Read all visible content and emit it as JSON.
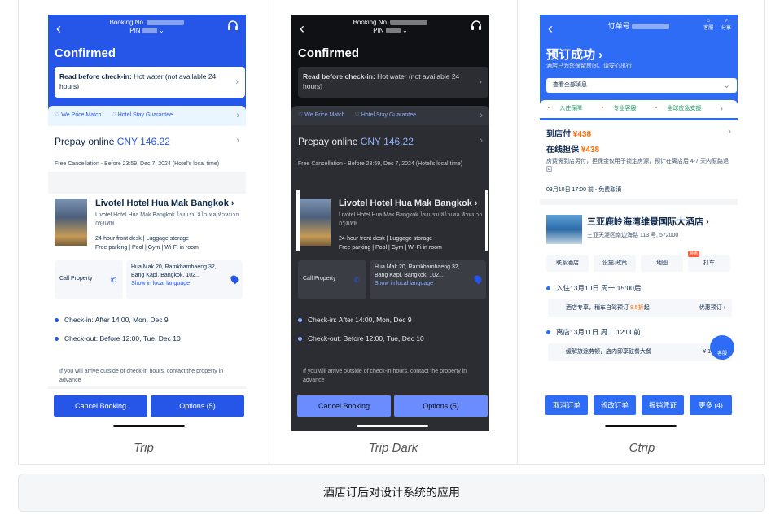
{
  "panels": [
    {
      "caption": "Trip",
      "booking": "Booking No.",
      "pin": "PIN",
      "title": "Confirmed",
      "notice_bold": "Read before check-in:",
      "notice_text": " Hot water (not available 24 hours)",
      "guar1": "We Price Match",
      "guar2": "Hotel Stay Guarantee",
      "prepay_label": "Prepay online ",
      "prepay_amount": "CNY 146.22",
      "free_cancel": "Free Cancellation - Before 23:59, Dec 7, 2024 (Hotel's local time)",
      "hotel_name": "Livotel Hotel Hua Mak Bangkok",
      "hotel_sub": "Livotel Hotel Hua Mak Bangkok โรงแรม ลิโวเทล หัวหมาก กรุงเทพ",
      "fac1": "24-hour front desk | Luggage storage",
      "fac2": "Free parking | Pool | Gym | Wi-Fi in room",
      "call": "Call Property",
      "address": "Hua Mak 20, Ramkhamhaeng 32, Bang Kapi, Bangkok, 102...",
      "local_lang": "Show in local language",
      "checkin": "Check-in: After 14:00, Mon, Dec 9",
      "checkout": "Check-out: Before 12:00, Tue, Dec 10",
      "note": "If you will arrive outside of check-in hours, contact the property in advance",
      "btn_cancel": "Cancel Booking",
      "btn_options": "Options (5)"
    },
    {
      "caption": "Trip Dark",
      "booking": "Booking No.",
      "pin": "PIN",
      "title": "Confirmed",
      "notice_bold": "Read before check-in:",
      "notice_text": " Hot water (not available 24 hours)",
      "guar1": "We Price Match",
      "guar2": "Hotel Stay Guarantee",
      "prepay_label": "Prepay online ",
      "prepay_amount": "CNY 146.22",
      "free_cancel": "Free Cancellation - Before 23:59, Dec 7, 2024 (Hotel's local time)",
      "hotel_name": "Livotel Hotel Hua Mak Bangkok",
      "hotel_sub": "Livotel Hotel Hua Mak Bangkok โรงแรม ลิโวเทล หัวหมาก กรุงเทพ",
      "fac1": "24-hour front desk | Luggage storage",
      "fac2": "Free parking | Pool | Gym | Wi-Fi in room",
      "call": "Call Property",
      "address": "Hua Mak 20, Ramkhamhaeng 32, Bang Kapi, Bangkok, 102...",
      "local_lang": "Show in local language",
      "checkin": "Check-in: After 14:00, Mon, Dec 9",
      "checkout": "Check-out: Before 12:00, Tue, Dec 10",
      "note": "If you will arrive outside of check-in hours, contact the property in advance",
      "btn_cancel": "Cancel Booking",
      "btn_options": "Options (5)"
    }
  ],
  "ctrip": {
    "caption": "Ctrip",
    "order_no": "订单号",
    "icon_service": "客服",
    "icon_share": "分享",
    "title": "预订成功",
    "subtitle": "酒店已为您保留房间，请安心出行",
    "select": "查看全部消息",
    "guar1": "入住保障",
    "guar2": "专业客服",
    "guar3": "全球应急支援",
    "pay_hotel": "到店付",
    "pay_hotel_amt": "¥438",
    "pay_deposit": "在线担保",
    "pay_deposit_amt": "¥438",
    "desc": "房费需到店另付，担保金仅用于锁定房源，预计在离店后 4-7 天内原路退回",
    "cancel": "03月10日 17:00 前 - 免费取消",
    "hotel_name": "三亚鹿岭海湾维景国际大酒店",
    "hotel_addr": "三亚天涯区南边海路 113 号, 572000",
    "chip1": "联系酒店",
    "chip2": "设施·政策",
    "chip3": "地图",
    "chip4": "打车",
    "chip4_tag": "特惠",
    "checkin": "入住:  3月10日 周一 15:00后",
    "transfer": "酒店专享，稍车自驾预订",
    "transfer_discount": "8.5折",
    "transfer_suffix": "起",
    "transfer_link": "优惠预订",
    "checkout": "离店:  3月11日 周二 12:00前",
    "food": "缓解旅途劳顿，店内即享鼓餐大餐",
    "food_price": "¥ 1",
    "badge": "客服",
    "btn1": "取消订单",
    "btn2": "修改订单",
    "btn3": "报销凭证",
    "btn4": "更多 (4)"
  },
  "footer": "酒店订后对设计系统的应用",
  "colors": {
    "trip_blue": "#2656e8",
    "ctrip_blue": "#2f6cf6",
    "dark_bg": "#2b2d33"
  }
}
